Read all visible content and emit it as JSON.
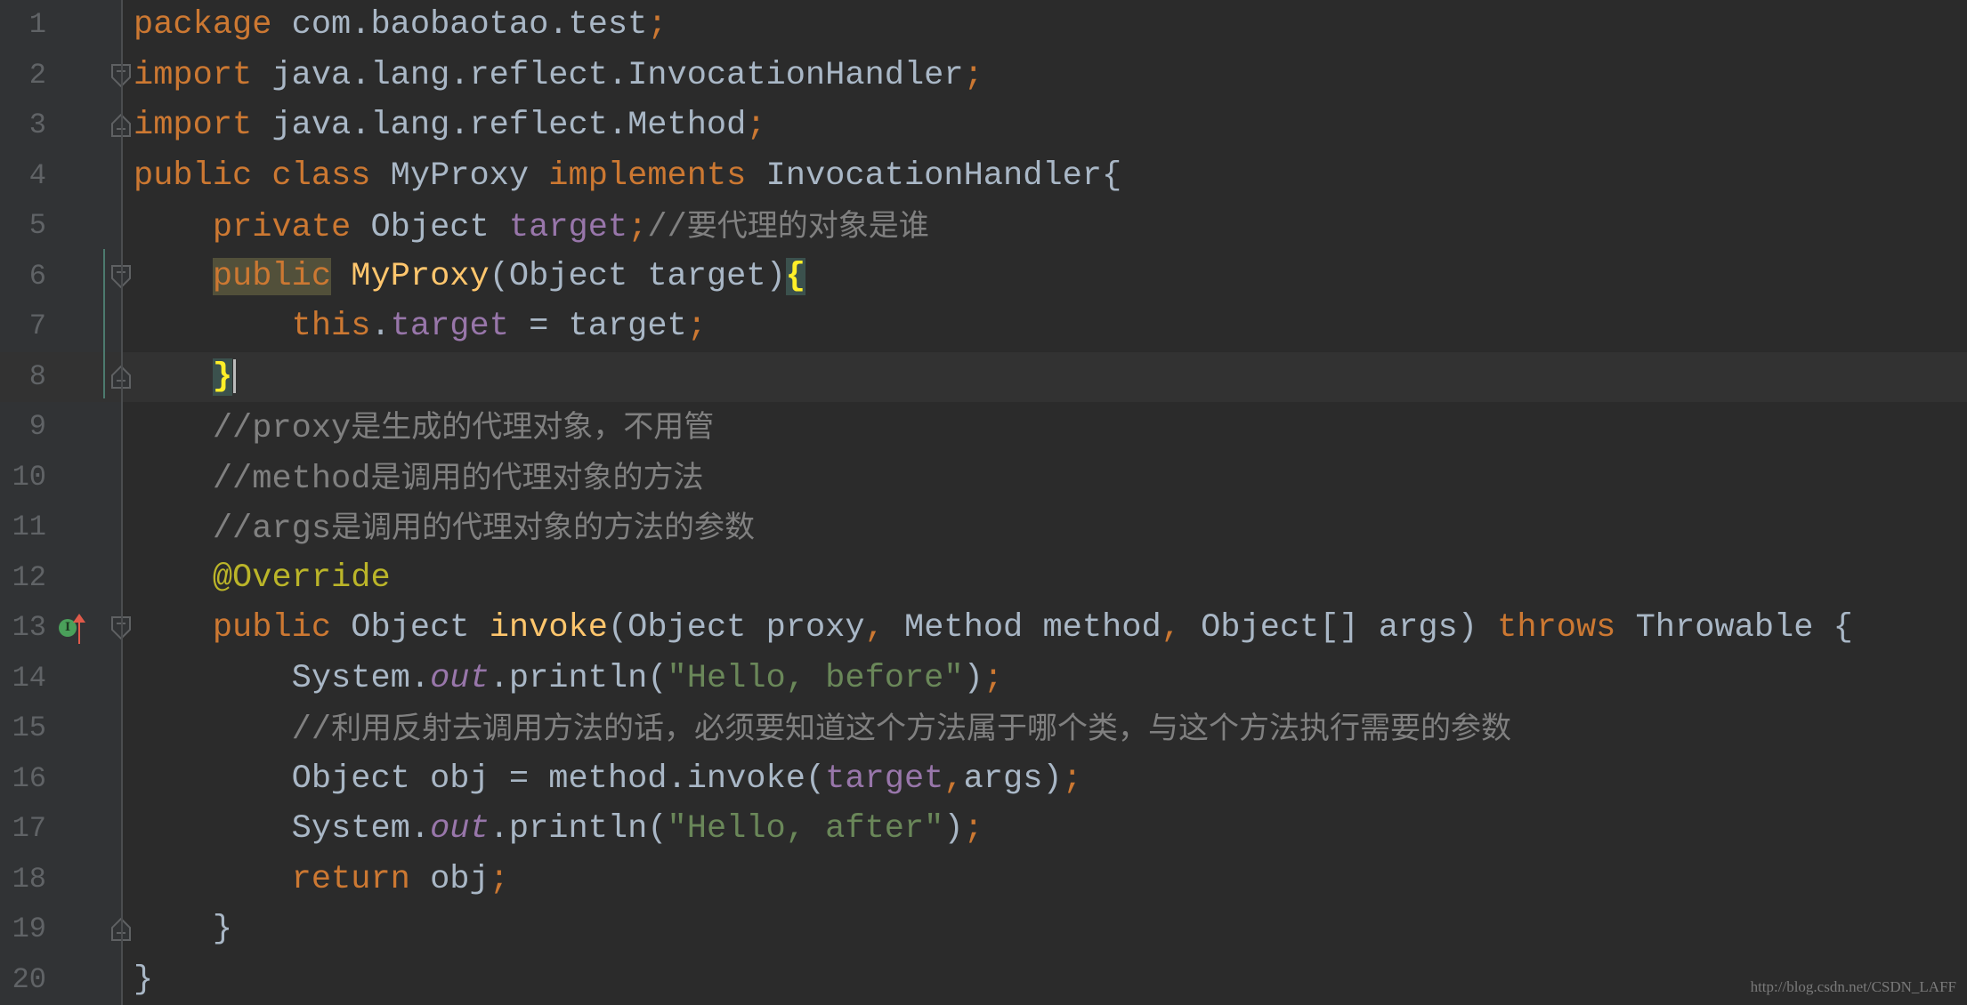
{
  "editor": {
    "language": "java",
    "current_line": 8,
    "lines": [
      {
        "n": "1",
        "tokens": [
          [
            "kw",
            "package"
          ],
          [
            "id",
            " com.baobaotao.test"
          ],
          [
            "punct",
            ";"
          ]
        ]
      },
      {
        "n": "2",
        "fold": "start",
        "tokens": [
          [
            "kw",
            "import"
          ],
          [
            "id",
            " java.lang.reflect.InvocationHandler"
          ],
          [
            "punct",
            ";"
          ]
        ]
      },
      {
        "n": "3",
        "fold": "end",
        "tokens": [
          [
            "kw",
            "import"
          ],
          [
            "id",
            " java.lang.reflect.Method"
          ],
          [
            "punct",
            ";"
          ]
        ]
      },
      {
        "n": "4",
        "tokens": [
          [
            "kw",
            "public class "
          ],
          [
            "id",
            "MyProxy "
          ],
          [
            "kw",
            "implements "
          ],
          [
            "id",
            "InvocationHandler{"
          ]
        ]
      },
      {
        "n": "5",
        "tokens": [
          [
            "id",
            "    "
          ],
          [
            "kw",
            "private "
          ],
          [
            "id",
            "Object "
          ],
          [
            "field",
            "target"
          ],
          [
            "punct",
            ";"
          ],
          [
            "cmt",
            "//"
          ],
          [
            "cmtcjk",
            "要代理的对象是谁"
          ]
        ]
      },
      {
        "n": "6",
        "fold": "start",
        "tokens": [
          [
            "id",
            "    "
          ],
          [
            "kwhl",
            "public"
          ],
          [
            "id",
            " "
          ],
          [
            "decl",
            "MyProxy"
          ],
          [
            "id",
            "(Object target)"
          ],
          [
            "brace",
            "{"
          ]
        ]
      },
      {
        "n": "7",
        "tokens": [
          [
            "id",
            "        "
          ],
          [
            "kw",
            "this"
          ],
          [
            "id",
            "."
          ],
          [
            "field",
            "target"
          ],
          [
            "id",
            " = target"
          ],
          [
            "punct",
            ";"
          ]
        ]
      },
      {
        "n": "8",
        "fold": "end",
        "caret": true,
        "tokens": [
          [
            "id",
            "    "
          ],
          [
            "brace",
            "}"
          ]
        ]
      },
      {
        "n": "9",
        "tokens": [
          [
            "id",
            "    "
          ],
          [
            "cmt",
            "//proxy"
          ],
          [
            "cmtcjk",
            "是生成的代理对象，不用管"
          ]
        ]
      },
      {
        "n": "10",
        "tokens": [
          [
            "id",
            "    "
          ],
          [
            "cmt",
            "//method"
          ],
          [
            "cmtcjk",
            "是调用的代理对象的方法"
          ]
        ]
      },
      {
        "n": "11",
        "tokens": [
          [
            "id",
            "    "
          ],
          [
            "cmt",
            "//args"
          ],
          [
            "cmtcjk",
            "是调用的代理对象的方法的参数"
          ]
        ]
      },
      {
        "n": "12",
        "tokens": [
          [
            "id",
            "    "
          ],
          [
            "ann",
            "@Override"
          ]
        ]
      },
      {
        "n": "13",
        "fold": "start",
        "gutter_icons": [
          "implements-method-icon",
          "override-up-arrow-icon"
        ],
        "tokens": [
          [
            "id",
            "    "
          ],
          [
            "kw",
            "public "
          ],
          [
            "id",
            "Object "
          ],
          [
            "decl",
            "invoke"
          ],
          [
            "id",
            "(Object proxy"
          ],
          [
            "punct",
            ","
          ],
          [
            "id",
            " Method method"
          ],
          [
            "punct",
            ","
          ],
          [
            "id",
            " Object[] args) "
          ],
          [
            "kw",
            "throws "
          ],
          [
            "id",
            "Throwable {"
          ]
        ]
      },
      {
        "n": "14",
        "tokens": [
          [
            "id",
            "        System."
          ],
          [
            "static",
            "out"
          ],
          [
            "id",
            ".println("
          ],
          [
            "str",
            "\"Hello, before\""
          ],
          [
            "id",
            ")"
          ],
          [
            "punct",
            ";"
          ]
        ]
      },
      {
        "n": "15",
        "tokens": [
          [
            "id",
            "        "
          ],
          [
            "cmt",
            "//"
          ],
          [
            "cmtcjk",
            "利用反射去调用方法的话，必须要知道这个方法属于哪个类，与这个方法执行需要的参数"
          ]
        ]
      },
      {
        "n": "16",
        "tokens": [
          [
            "id",
            "        Object obj = method.invoke("
          ],
          [
            "field",
            "target"
          ],
          [
            "punct",
            ","
          ],
          [
            "id",
            "args)"
          ],
          [
            "punct",
            ";"
          ]
        ]
      },
      {
        "n": "17",
        "tokens": [
          [
            "id",
            "        System."
          ],
          [
            "static",
            "out"
          ],
          [
            "id",
            ".println("
          ],
          [
            "str",
            "\"Hello, after\""
          ],
          [
            "id",
            ")"
          ],
          [
            "punct",
            ";"
          ]
        ]
      },
      {
        "n": "18",
        "tokens": [
          [
            "id",
            "        "
          ],
          [
            "kw",
            "return "
          ],
          [
            "id",
            "obj"
          ],
          [
            "punct",
            ";"
          ]
        ]
      },
      {
        "n": "19",
        "fold": "end",
        "tokens": [
          [
            "id",
            "    }"
          ]
        ]
      },
      {
        "n": "20",
        "tokens": [
          [
            "id",
            "}"
          ]
        ]
      }
    ]
  },
  "watermark": "http://blog.csdn.net/CSDN_LAFF",
  "colors": {
    "background": "#2b2b2b",
    "gutter": "#313335",
    "keyword": "#cc7832",
    "identifier": "#a9b7c6",
    "field": "#9876aa",
    "string": "#6a8759",
    "comment": "#808080",
    "annotation": "#bbb529",
    "method_declaration": "#ffc66d",
    "brace_match": "#ffef28"
  }
}
